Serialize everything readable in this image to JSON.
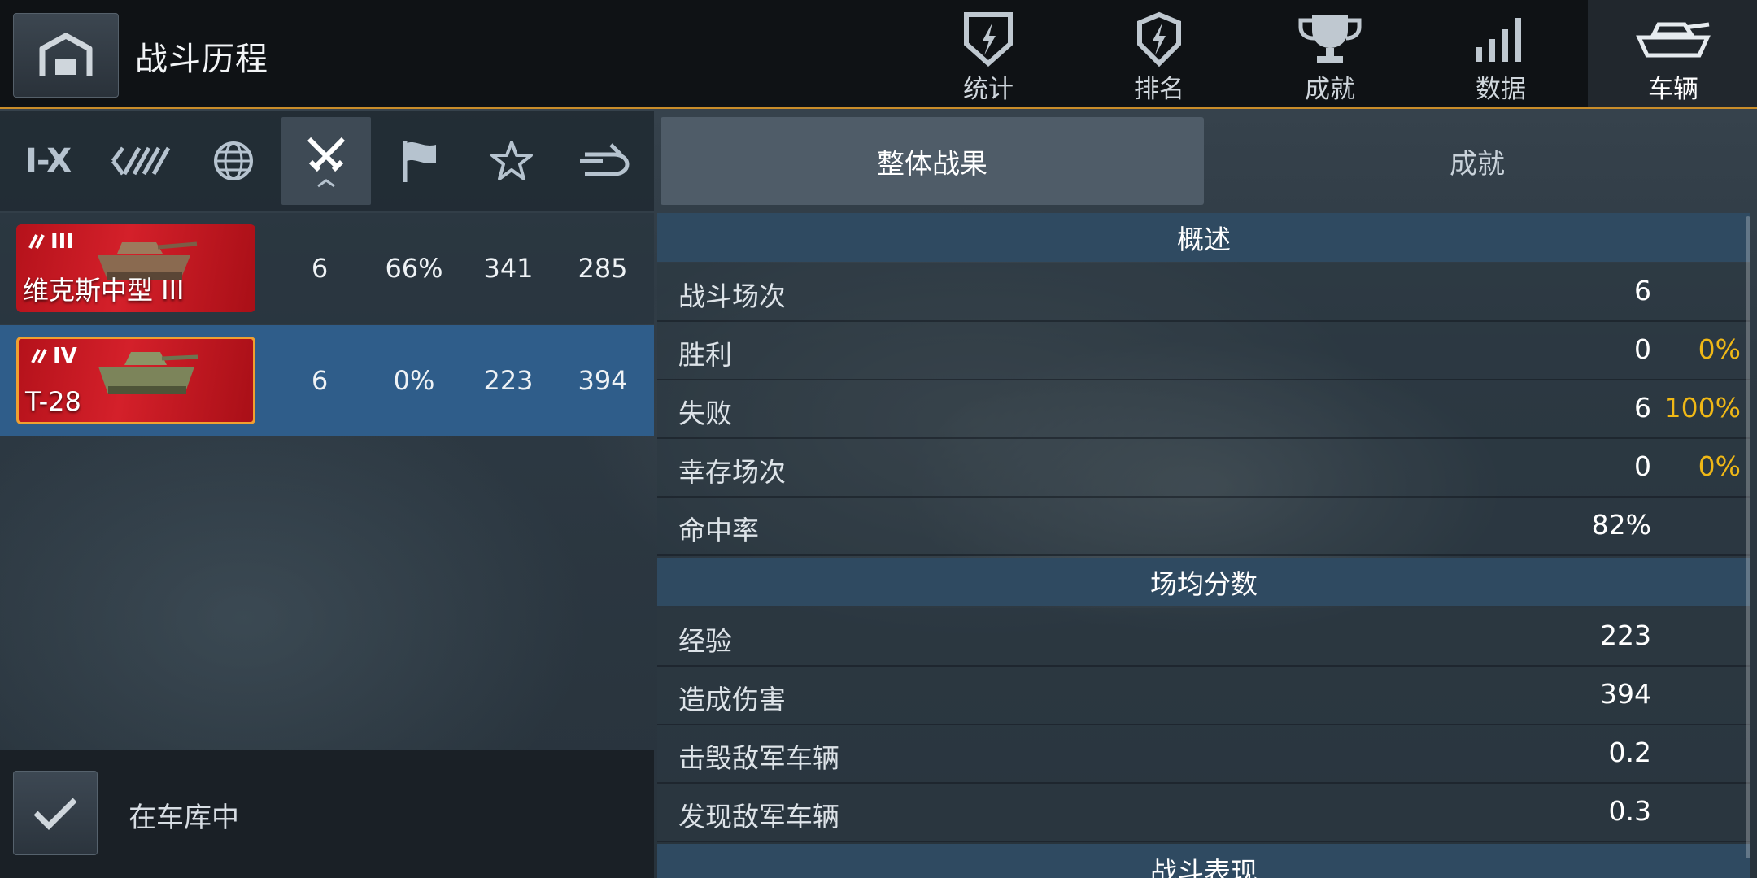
{
  "header": {
    "title": "战斗历程",
    "tabs": [
      {
        "label": "统计",
        "icon": "shield-bolt-icon"
      },
      {
        "label": "排名",
        "icon": "badge-bolt-icon"
      },
      {
        "label": "成就",
        "icon": "trophy-icon"
      },
      {
        "label": "数据",
        "icon": "bar-chart-icon"
      },
      {
        "label": "车辆",
        "icon": "tank-icon",
        "active": true
      }
    ]
  },
  "filters": {
    "tier_range": "I-X",
    "items": [
      "tier-range",
      "vehicle-class",
      "nation",
      "battle-type",
      "flag",
      "star",
      "premium-tank"
    ],
    "active": "battle-type"
  },
  "vehicles": [
    {
      "tier": "III",
      "name": "维克斯中型 III",
      "battles": "6",
      "winrate": "66%",
      "exp": "341",
      "damage": "285"
    },
    {
      "tier": "IV",
      "name": "T-28",
      "battles": "6",
      "winrate": "0%",
      "exp": "223",
      "damage": "394",
      "selected": true
    }
  ],
  "garage": {
    "label": "在车库中",
    "checked": true
  },
  "segments": {
    "overall": "整体战果",
    "achievements": "成就"
  },
  "sections": {
    "overview": {
      "title": "概述",
      "rows": [
        {
          "label": "战斗场次",
          "value": "6",
          "pct": ""
        },
        {
          "label": "胜利",
          "value": "0",
          "pct": "0%"
        },
        {
          "label": "失败",
          "value": "6",
          "pct": "100%"
        },
        {
          "label": "幸存场次",
          "value": "0",
          "pct": "0%"
        },
        {
          "label": "命中率",
          "value": "82%",
          "pct": ""
        }
      ]
    },
    "average": {
      "title": "场均分数",
      "rows": [
        {
          "label": "经验",
          "value": "223",
          "pct": ""
        },
        {
          "label": "造成伤害",
          "value": "394",
          "pct": ""
        },
        {
          "label": "击毁敌军车辆",
          "value": "0.2",
          "pct": ""
        },
        {
          "label": "发现敌军车辆",
          "value": "0.3",
          "pct": ""
        }
      ]
    },
    "performance": {
      "title": "战斗表现"
    }
  },
  "colors": {
    "accent_orange": "#c98d2a",
    "pct_yellow": "#f0b816",
    "selected_blue": "#2f5d8a",
    "card_red": "#c8161f"
  }
}
